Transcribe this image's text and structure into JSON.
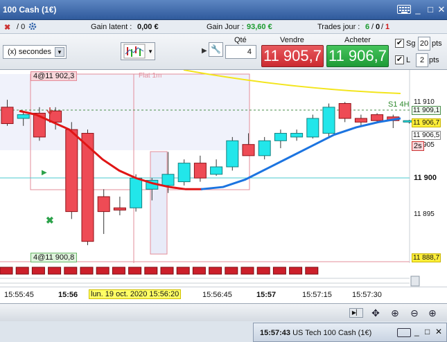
{
  "window": {
    "title": "100 Cash (1€)",
    "minimize": "_",
    "maximize": "□",
    "close": "✕"
  },
  "status": {
    "left_counter": "/ 0",
    "latent_label": "Gain latent :",
    "latent_value": "0,00 €",
    "day_label": "Gain Jour :",
    "day_value": "93,60 €",
    "trades_label": "Trades jour :",
    "trades_a": "6",
    "trades_sep1": "/",
    "trades_b": "0",
    "trades_sep2": "/",
    "trades_c": "1",
    "colors": {
      "gain": "#1a9a2e",
      "loss": "#d01818"
    }
  },
  "toolbar": {
    "period_select": "(x) secondes",
    "qty_label": "Qté",
    "qty_value": "4",
    "sell_label": "Vendre",
    "buy_label": "Acheter",
    "sell_price": "11 905,7",
    "buy_price": "11 906,7",
    "sg_label": "Sg",
    "sg_value": "20",
    "sg_unit": "pts",
    "l_label": "L",
    "l_value": "2",
    "l_unit": "pts",
    "colors": {
      "sell": "#d42f35",
      "buy": "#27a33d"
    }
  },
  "chart": {
    "title_tag": "Flat 1m",
    "order_top": "4@11 902,3",
    "order_bottom": "4@11 900,8",
    "level_label": "S1 4H",
    "price_axis": [
      "11 910",
      "11 909,1",
      "11 906,7",
      "11 906,5",
      "11 905",
      "11 900",
      "11 895",
      "11 888,7"
    ],
    "countdown": "2s",
    "time_axis": [
      "15:55:45",
      "15:56",
      "lun. 19 oct. 2020 15:56:20",
      "15:56:45",
      "15:57",
      "15:57:15",
      "15:57:30"
    ]
  },
  "chart_data": {
    "type": "candlestick",
    "interval": "5s",
    "price_range": [
      11887,
      11913
    ],
    "candles": [
      {
        "o": 11908.0,
        "h": 11909.0,
        "l": 11905.5,
        "c": 11905.8
      },
      {
        "o": 11906.5,
        "h": 11907.5,
        "l": 11905.5,
        "c": 11907.0
      },
      {
        "o": 11907.2,
        "h": 11908.0,
        "l": 11903.5,
        "c": 11904.0
      },
      {
        "o": 11907.5,
        "h": 11908.0,
        "l": 11905.0,
        "c": 11906.0
      },
      {
        "o": 11905.0,
        "h": 11906.0,
        "l": 11893.0,
        "c": 11894.0
      },
      {
        "o": 11904.5,
        "h": 11905.0,
        "l": 11889.5,
        "c": 11890.0
      },
      {
        "o": 11896.0,
        "h": 11897.0,
        "l": 11891.0,
        "c": 11894.0
      },
      {
        "o": 11894.5,
        "h": 11896.0,
        "l": 11893.5,
        "c": 11894.2
      },
      {
        "o": 11894.5,
        "h": 11899.0,
        "l": 11894.0,
        "c": 11898.5
      },
      {
        "o": 11897.0,
        "h": 11898.5,
        "l": 11895.5,
        "c": 11898.2
      },
      {
        "o": 11897.5,
        "h": 11902.0,
        "l": 11896.5,
        "c": 11899.0
      },
      {
        "o": 11898.0,
        "h": 11901.0,
        "l": 11897.5,
        "c": 11900.5
      },
      {
        "o": 11900.5,
        "h": 11901.5,
        "l": 11898.0,
        "c": 11898.5
      },
      {
        "o": 11899.0,
        "h": 11901.0,
        "l": 11898.8,
        "c": 11900.0
      },
      {
        "o": 11900.0,
        "h": 11904.0,
        "l": 11899.5,
        "c": 11903.5
      },
      {
        "o": 11903.0,
        "h": 11904.5,
        "l": 11901.5,
        "c": 11901.5
      },
      {
        "o": 11901.5,
        "h": 11904.0,
        "l": 11901.0,
        "c": 11903.5
      },
      {
        "o": 11903.5,
        "h": 11905.0,
        "l": 11902.5,
        "c": 11904.5
      },
      {
        "o": 11904.0,
        "h": 11905.0,
        "l": 11903.5,
        "c": 11904.5
      },
      {
        "o": 11904.0,
        "h": 11907.0,
        "l": 11903.8,
        "c": 11906.5
      },
      {
        "o": 11904.5,
        "h": 11908.5,
        "l": 11904.0,
        "c": 11908.0
      },
      {
        "o": 11908.5,
        "h": 11908.7,
        "l": 11906.0,
        "c": 11906.5
      },
      {
        "o": 11906.5,
        "h": 11907.0,
        "l": 11905.5,
        "c": 11906.0
      },
      {
        "o": 11907.0,
        "h": 11907.2,
        "l": 11906.0,
        "c": 11906.2
      },
      {
        "o": 11906.7,
        "h": 11907.0,
        "l": 11905.2,
        "c": 11906.2
      },
      {
        "o": 11906.0,
        "h": 11906.3,
        "l": 11905.8,
        "c": 11906.2
      }
    ],
    "moving_average_red": [
      11907.5,
      11907.0,
      11906.0,
      11905.0,
      11903.0,
      11901.0,
      11899.5,
      11898.5,
      11897.8,
      11897.3,
      11897.0,
      11897.0
    ],
    "moving_average_blue": [
      11897.0,
      11897.3,
      11898.3,
      11899.8,
      11901.3,
      11902.8,
      11904.3,
      11905.3,
      11906.0,
      11906.5
    ],
    "horizontal_levels": [
      11909.1,
      11900.0
    ],
    "current_price": 11906.7
  }
}
